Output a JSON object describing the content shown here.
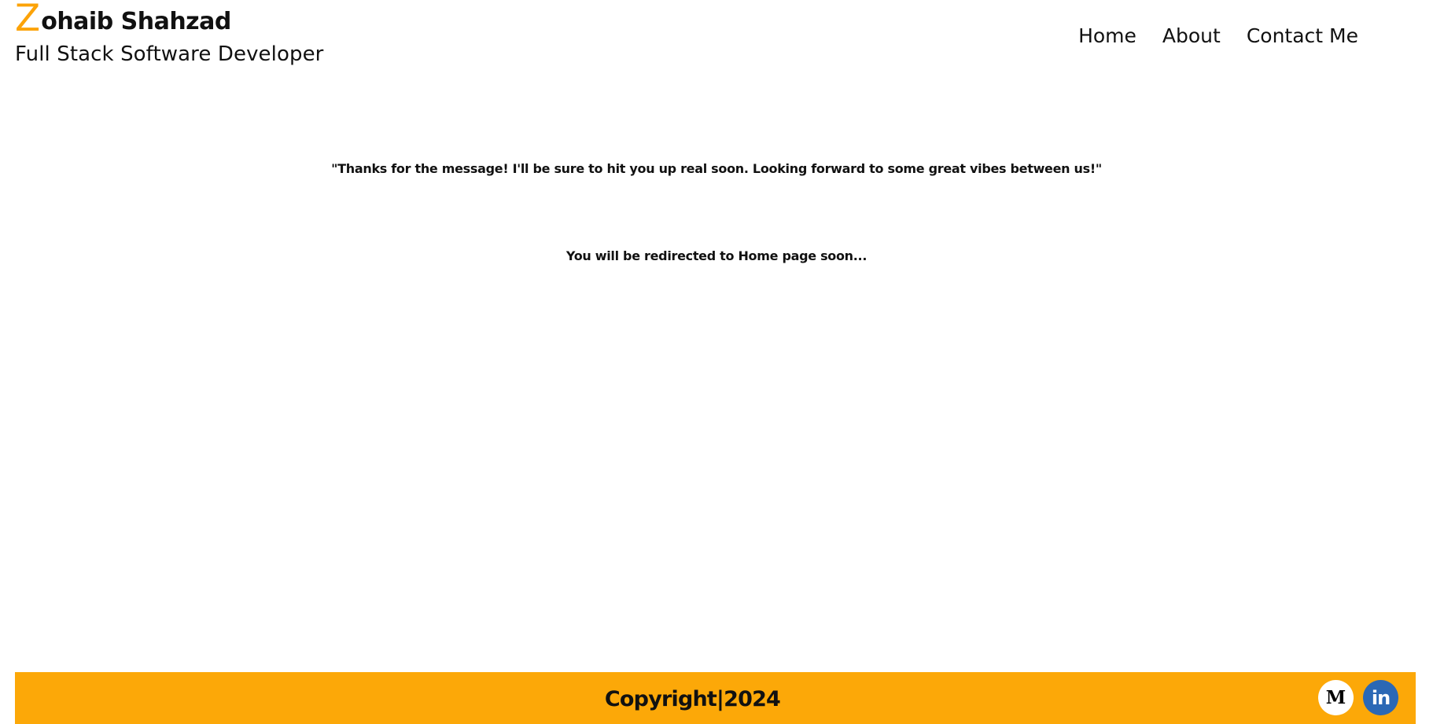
{
  "header": {
    "brand": {
      "initial": "Z",
      "rest": "ohaib Shahzad",
      "tagline": "Full Stack Software Developer"
    },
    "nav": [
      {
        "label": "Home"
      },
      {
        "label": "About"
      },
      {
        "label": "Contact Me"
      }
    ]
  },
  "main": {
    "thanks_message": "\"Thanks for the message! I'll be sure to hit you up real soon. Looking forward to some great vibes between us!\"",
    "redirect_message": "You will be redirected to Home page soon..."
  },
  "footer": {
    "copyright": "Copyright|2024",
    "socials": [
      {
        "icon": "medium-icon",
        "glyph": "M",
        "color": "#ffffff"
      },
      {
        "icon": "linkedin-icon",
        "glyph": "in",
        "color": "#2b68b5"
      }
    ]
  },
  "colors": {
    "accent": "#fca808",
    "text": "#111111",
    "background": "#ffffff"
  }
}
